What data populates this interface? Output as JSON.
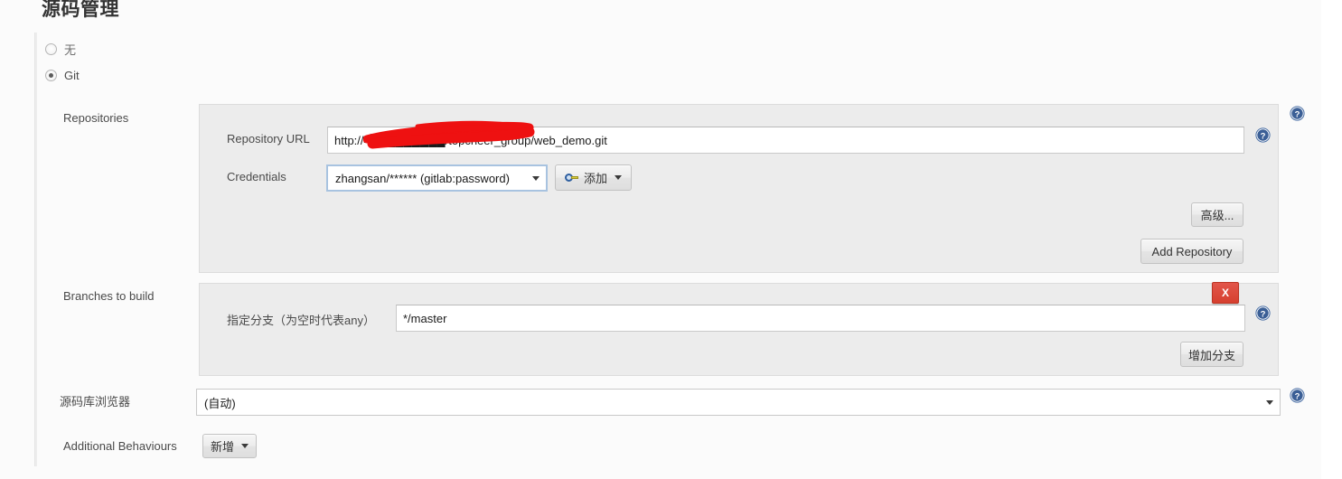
{
  "section": {
    "title": "源码管理"
  },
  "scm_options": [
    {
      "label": "无",
      "selected": false
    },
    {
      "label": "Git",
      "selected": true
    }
  ],
  "repositories": {
    "label": "Repositories",
    "repository_url": {
      "label": "Repository URL",
      "value": "http://4█████████/topcheer_group/web_demo.git",
      "redacted": true,
      "redaction_color": "#ee1111"
    },
    "credentials": {
      "label": "Credentials",
      "selected": "zhangsan/****** (gitlab:password)",
      "add_button": "添加",
      "add_button_icon": "key-icon",
      "caret_icon": "chevron-down-icon"
    },
    "advanced_button": "高级...",
    "add_repository_button": "Add Repository"
  },
  "branches": {
    "label": "Branches to build",
    "spec_label": "指定分支（为空时代表any）",
    "spec_value": "*/master",
    "delete_button": "X",
    "add_branch_button": "增加分支"
  },
  "repo_browser": {
    "label": "源码库浏览器",
    "selected": "(自动)",
    "caret_icon": "chevron-down-icon"
  },
  "additional_behaviours": {
    "label": "Additional Behaviours",
    "add_button": "新增",
    "caret_icon": "chevron-down-icon"
  },
  "help_icons": {
    "name": "help-icon",
    "glyph": "?",
    "color": "#3b5f96"
  },
  "colors": {
    "page_background": "#ffffff",
    "pane_background": "#fbfbfb",
    "panel_background": "#ececec",
    "text": "#4a4a4a",
    "delete_red": "#d6402f",
    "focus_border": "#a8c3e0"
  }
}
